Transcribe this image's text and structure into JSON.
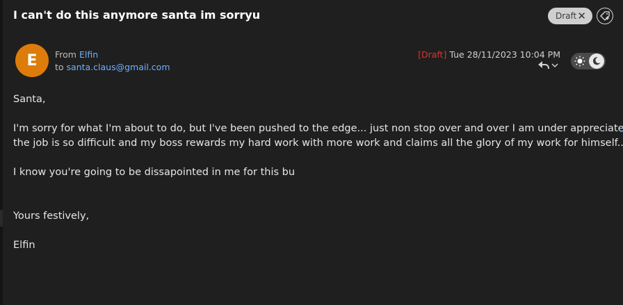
{
  "email": {
    "subject": "I can't do this anymore santa im sorryu",
    "status_badge": "Draft",
    "avatar_initial": "E",
    "from_prefix": "From",
    "from_name": "Elfin",
    "to_prefix": "to",
    "to_address": "santa.claus@gmail.com",
    "draft_marker": "[Draft]",
    "date": "Tue 28/11/2023 10:04 PM",
    "body": {
      "greeting": "Santa,",
      "para1_line1": "I'm sorry for what I'm about to do, but I've been pushed to the edge... just non stop over and over I am under appreciated,",
      "para1_line2": "the job is so difficult and my boss rewards my hard work with more work and claims all the glory of my work for himself..",
      "para2": "I know you're going to be dissapointed in me for this bu",
      "signoff": "Yours festively,",
      "signature": "Elfin"
    }
  },
  "colors": {
    "background": "#1f1f1f",
    "avatar": "#dd7c0a",
    "link": "#6fb0ff",
    "draft_red": "#e0332f"
  },
  "icons": [
    "close-icon",
    "tag-add-icon",
    "reply-icon",
    "chevron-down-icon",
    "sun-icon",
    "moon-icon"
  ]
}
